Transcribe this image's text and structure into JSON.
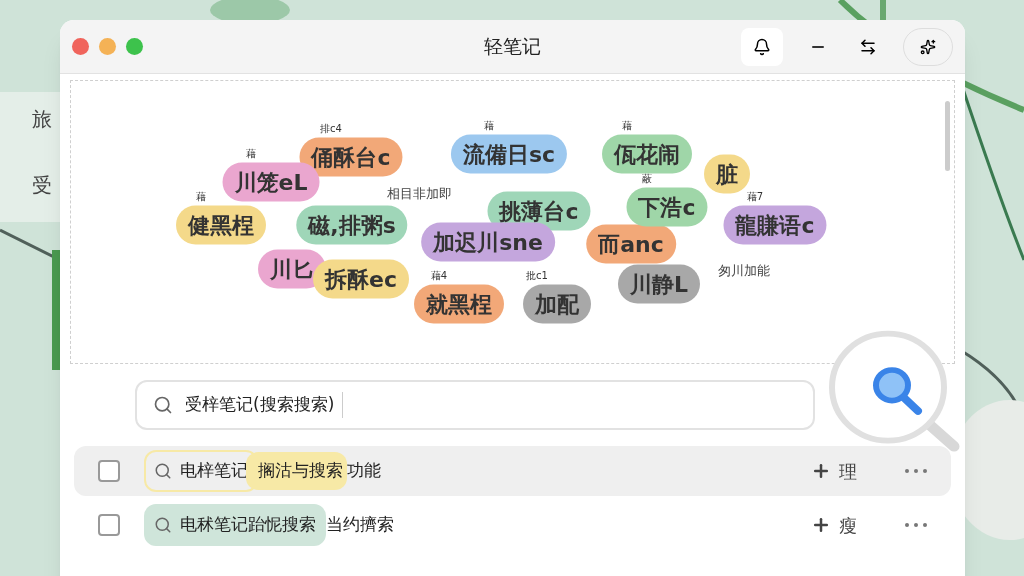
{
  "background_window": {
    "items": [
      "旅",
      "受"
    ]
  },
  "window": {
    "title": "轻笔记"
  },
  "canvas": {
    "bubbles": [
      {
        "kind": "bubble",
        "text": "俑酥台c",
        "label": "排c4",
        "color": "#f2a878"
      },
      {
        "kind": "bubble",
        "text": "流備日sc",
        "label": "藉",
        "color": "#9cc8ef"
      },
      {
        "kind": "bubble",
        "text": "佤花闹",
        "label": "藉",
        "color": "#9fd6a8"
      },
      {
        "kind": "bubble",
        "text": "川笼eL",
        "label": "藉",
        "color": "#eaa6cf"
      },
      {
        "kind": "bubble",
        "text": "脏",
        "color": "#f4d98a"
      },
      {
        "kind": "bubble",
        "text": "健黑桯",
        "label": "藉",
        "color": "#f4d98a"
      },
      {
        "kind": "bubble",
        "text": "磁,排粥s",
        "color": "#9fd6b8"
      },
      {
        "kind": "plain",
        "text": "相目非加即"
      },
      {
        "kind": "bubble",
        "text": "挑薄台c",
        "color": "#9fd6b8"
      },
      {
        "kind": "bubble",
        "text": "下浩c",
        "label": "蔽",
        "color": "#9fd6a8"
      },
      {
        "kind": "bubble",
        "text": "龍賺语c",
        "label": "藉7",
        "color": "#c4a6dd"
      },
      {
        "kind": "bubble",
        "text": "加迟川sne",
        "color": "#c4a6dd"
      },
      {
        "kind": "bubble",
        "text": "而anc",
        "color": "#f2a878"
      },
      {
        "kind": "bubble",
        "text": "川匕",
        "color": "#eaa6cf"
      },
      {
        "kind": "bubble",
        "text": "拆酥ec",
        "color": "#f4d98a"
      },
      {
        "kind": "bubble",
        "text": "就黑桯",
        "label": "藉4",
        "color": "#f2a878"
      },
      {
        "kind": "bubble",
        "text": "加配",
        "label": "批c1",
        "color": "#a8a8a8"
      },
      {
        "kind": "bubble",
        "text": "川静L",
        "color": "#a8a8a8"
      },
      {
        "kind": "plain",
        "text": "匆川加能"
      }
    ]
  },
  "search": {
    "value": "受梓笔记(搜索搜索)"
  },
  "results": [
    {
      "selected": true,
      "checked": false,
      "query": "电梓笔记",
      "color": "#f7e9a6",
      "highlight": "搁沽与搜索",
      "rest": "功能",
      "action": "理",
      "chip_filled": false
    },
    {
      "selected": false,
      "checked": false,
      "query": "电秫笔记跆怩搜索",
      "color": "#cfe5da",
      "rest": "当约擠索",
      "action": "瘦",
      "chip_filled": true
    }
  ]
}
